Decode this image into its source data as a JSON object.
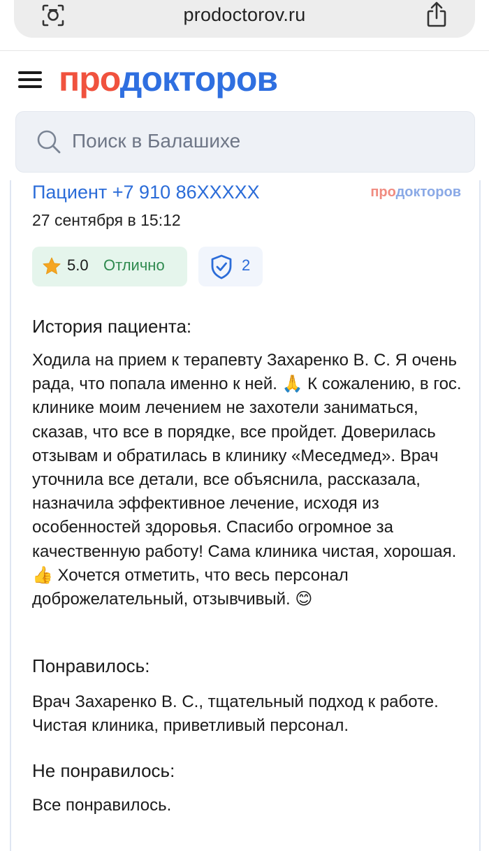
{
  "browser": {
    "url": "prodoctorov.ru",
    "reader_icon": "reader-mode-icon",
    "share_icon": "share-icon"
  },
  "header": {
    "logo_part1": "про",
    "logo_part2": "докторов",
    "menu_icon": "hamburger-menu-icon",
    "search_placeholder": "Поиск в Балашихе",
    "search_icon": "search-icon"
  },
  "review": {
    "author": "Пациент +7 910 86XXXXX",
    "date": "27 сентября в 15:12",
    "watermark_part1": "про",
    "watermark_part2": "докторов",
    "rating": {
      "value": "5.0",
      "label": "Отлично",
      "icon": "star-icon",
      "color": "#2f8a4f"
    },
    "verification": {
      "count": "2",
      "icon": "shield-check-icon"
    },
    "story": {
      "title": "История пациента:",
      "text": "Ходила на прием к терапевту Захаренко В. С. Я очень рада, что попала именно к ней. 🙏 К сожалению, в гос. клинике моим лечением не захотели заниматься, сказав, что все в порядке, все пройдет. Доверилась отзывам и обратилась в клинику «Меседмед». Врач уточнила все детали, все объяснила, рассказала, назначила эффективное лечение, исходя из особенностей здоровья. Спасибо огромное за качественную работу! Сама клиника чистая, хорошая. 👍 Хочется отметить, что весь персонал доброжелательный, отзывчивый. 😊"
    },
    "liked": {
      "title": "Понравилось:",
      "text": "Врач Захаренко В. С., тщательный подход к работе. Чистая клиника, приветливый персонал."
    },
    "disliked": {
      "title": "Не понравилось:",
      "text": "Все понравилось."
    }
  },
  "colors": {
    "brand_red": "#f0523e",
    "brand_blue": "#2f6fe0",
    "link_blue": "#2b6cd8",
    "rating_bg": "#e5f5ec"
  }
}
